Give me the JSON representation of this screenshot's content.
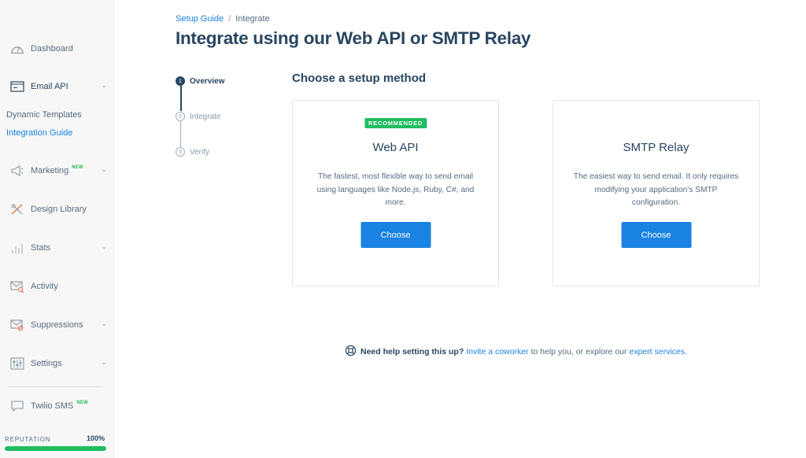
{
  "sidebar": {
    "items": [
      {
        "label": "Dashboard",
        "icon": "gauge-icon"
      },
      {
        "label": "Email API",
        "icon": "api-icon"
      },
      {
        "label": "Marketing",
        "icon": "megaphone-icon",
        "badge": "NEW"
      },
      {
        "label": "Design Library",
        "icon": "design-tools-icon"
      },
      {
        "label": "Stats",
        "icon": "chart-icon"
      },
      {
        "label": "Activity",
        "icon": "mail-search-icon"
      },
      {
        "label": "Suppressions",
        "icon": "mail-block-icon"
      },
      {
        "label": "Settings",
        "icon": "sliders-icon"
      },
      {
        "label": "Twilio SMS",
        "icon": "chat-icon",
        "badge": "NEW"
      }
    ],
    "subitems": [
      {
        "label": "Dynamic Templates"
      },
      {
        "label": "Integration Guide"
      }
    ],
    "reputation": {
      "label": "REPUTATION",
      "value": "100%",
      "fraction": 1.0
    }
  },
  "breadcrumb": {
    "parent": "Setup Guide",
    "separator": "/",
    "current": "Integrate"
  },
  "page_title": "Integrate using our Web API or SMTP Relay",
  "steps": [
    {
      "num": "1",
      "label": "Overview"
    },
    {
      "num": "2",
      "label": "Integrate"
    },
    {
      "num": "3",
      "label": "Verify"
    }
  ],
  "section_title": "Choose a setup method",
  "cards": [
    {
      "badge": "RECOMMENDED",
      "title": "Web API",
      "description": "The fastest, most flexible way to send email using languages like Node.js, Ruby, C#, and more.",
      "button": "Choose"
    },
    {
      "title": "SMTP Relay",
      "description": "The easiest way to send email. It only requires modifying your application's SMTP configuration.",
      "button": "Choose"
    }
  ],
  "help": {
    "icon": "lifebuoy-icon",
    "question": "Need help setting this up?",
    "link1": "Invite a coworker",
    "mid": " to help you, or explore our ",
    "link2": "expert services",
    "end": "."
  },
  "colors": {
    "accent": "#1a82e2",
    "success": "#1fbd60",
    "text": "#294661"
  }
}
